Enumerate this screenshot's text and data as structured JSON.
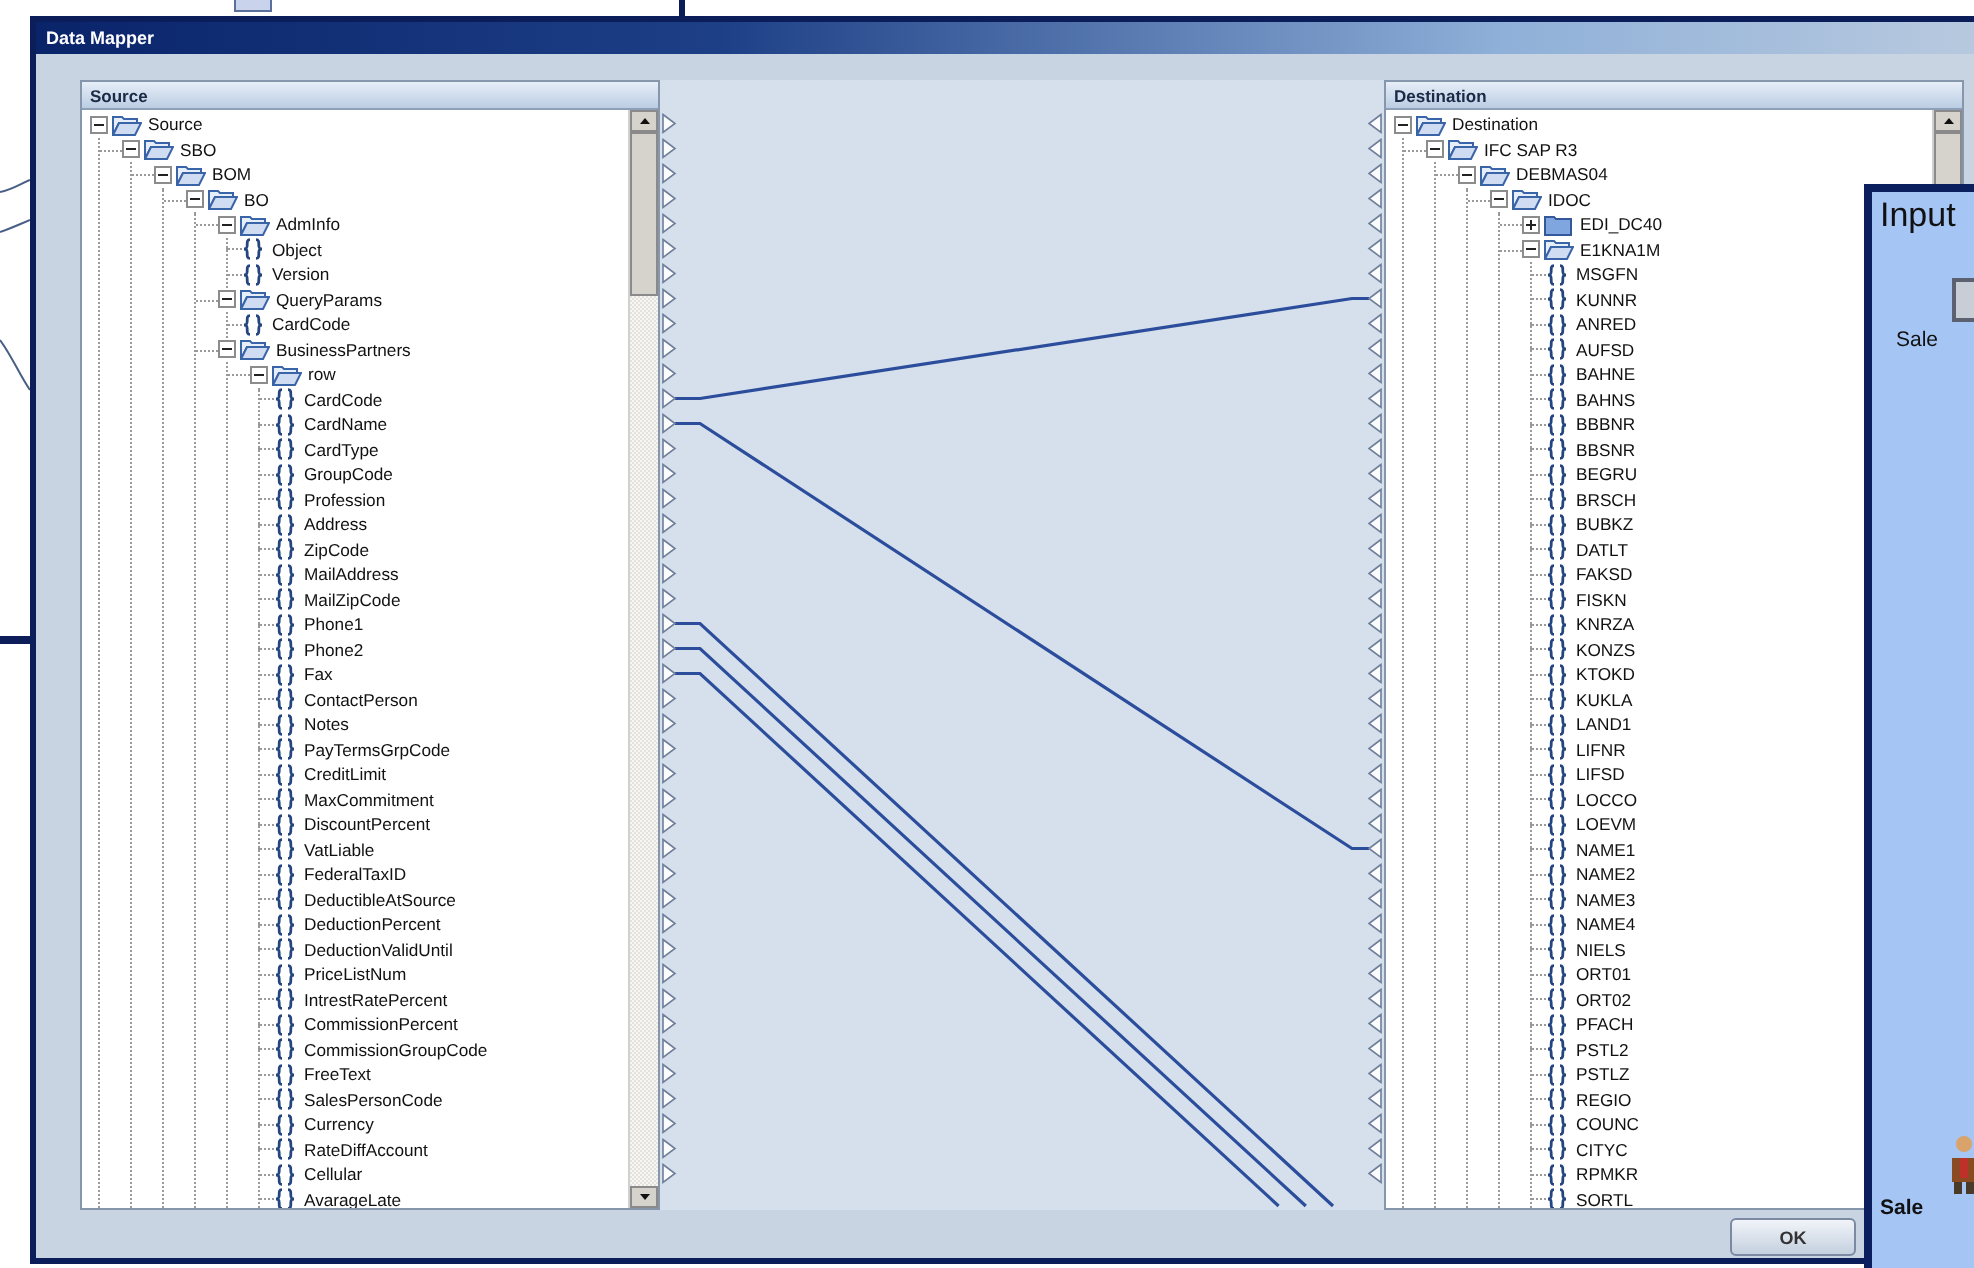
{
  "window": {
    "title": "Data Mapper"
  },
  "source": {
    "title": "Source",
    "tree": [
      {
        "label": "Source",
        "kind": "folder",
        "expanded": true,
        "children": [
          {
            "label": "SBO",
            "kind": "folder",
            "expanded": true,
            "children": [
              {
                "label": "BOM",
                "kind": "folder",
                "expanded": true,
                "children": [
                  {
                    "label": "BO",
                    "kind": "folder",
                    "expanded": true,
                    "children": [
                      {
                        "label": "AdmInfo",
                        "kind": "folder",
                        "expanded": true,
                        "children": [
                          {
                            "label": "Object",
                            "kind": "field",
                            "connected": false
                          },
                          {
                            "label": "Version",
                            "kind": "field",
                            "connected": false
                          }
                        ]
                      },
                      {
                        "label": "QueryParams",
                        "kind": "folder",
                        "expanded": true,
                        "children": [
                          {
                            "label": "CardCode",
                            "kind": "field",
                            "connected": false
                          }
                        ]
                      },
                      {
                        "label": "BusinessPartners",
                        "kind": "folder",
                        "expanded": true,
                        "children": [
                          {
                            "label": "row",
                            "kind": "folder",
                            "expanded": true,
                            "children": [
                              {
                                "label": "CardCode",
                                "kind": "field",
                                "connected": true
                              },
                              {
                                "label": "CardName",
                                "kind": "field",
                                "connected": true
                              },
                              {
                                "label": "CardType",
                                "kind": "field",
                                "connected": false
                              },
                              {
                                "label": "GroupCode",
                                "kind": "field",
                                "connected": false
                              },
                              {
                                "label": "Profession",
                                "kind": "field",
                                "connected": false
                              },
                              {
                                "label": "Address",
                                "kind": "field",
                                "connected": false
                              },
                              {
                                "label": "ZipCode",
                                "kind": "field",
                                "connected": false
                              },
                              {
                                "label": "MailAddress",
                                "kind": "field",
                                "connected": false
                              },
                              {
                                "label": "MailZipCode",
                                "kind": "field",
                                "connected": false
                              },
                              {
                                "label": "Phone1",
                                "kind": "field",
                                "connected": true
                              },
                              {
                                "label": "Phone2",
                                "kind": "field",
                                "connected": true
                              },
                              {
                                "label": "Fax",
                                "kind": "field",
                                "connected": true
                              },
                              {
                                "label": "ContactPerson",
                                "kind": "field",
                                "connected": false
                              },
                              {
                                "label": "Notes",
                                "kind": "field",
                                "connected": false
                              },
                              {
                                "label": "PayTermsGrpCode",
                                "kind": "field",
                                "connected": false
                              },
                              {
                                "label": "CreditLimit",
                                "kind": "field",
                                "connected": false
                              },
                              {
                                "label": "MaxCommitment",
                                "kind": "field",
                                "connected": false
                              },
                              {
                                "label": "DiscountPercent",
                                "kind": "field",
                                "connected": false
                              },
                              {
                                "label": "VatLiable",
                                "kind": "field",
                                "connected": false
                              },
                              {
                                "label": "FederalTaxID",
                                "kind": "field",
                                "connected": false
                              },
                              {
                                "label": "DeductibleAtSource",
                                "kind": "field",
                                "connected": false
                              },
                              {
                                "label": "DeductionPercent",
                                "kind": "field",
                                "connected": false
                              },
                              {
                                "label": "DeductionValidUntil",
                                "kind": "field",
                                "connected": false
                              },
                              {
                                "label": "PriceListNum",
                                "kind": "field",
                                "connected": false
                              },
                              {
                                "label": "IntrestRatePercent",
                                "kind": "field",
                                "connected": false
                              },
                              {
                                "label": "CommissionPercent",
                                "kind": "field",
                                "connected": false
                              },
                              {
                                "label": "CommissionGroupCode",
                                "kind": "field",
                                "connected": false
                              },
                              {
                                "label": "FreeText",
                                "kind": "field",
                                "connected": false
                              },
                              {
                                "label": "SalesPersonCode",
                                "kind": "field",
                                "connected": false
                              },
                              {
                                "label": "Currency",
                                "kind": "field",
                                "connected": false
                              },
                              {
                                "label": "RateDiffAccount",
                                "kind": "field",
                                "connected": false
                              },
                              {
                                "label": "Cellular",
                                "kind": "field",
                                "connected": false
                              },
                              {
                                "label": "AvarageLate",
                                "kind": "field",
                                "connected": false
                              }
                            ]
                          }
                        ]
                      }
                    ]
                  }
                ]
              }
            ]
          }
        ]
      }
    ]
  },
  "destination": {
    "title": "Destination",
    "tree": [
      {
        "label": "Destination",
        "kind": "folder",
        "expanded": true,
        "children": [
          {
            "label": "IFC SAP R3",
            "kind": "folder",
            "expanded": true,
            "children": [
              {
                "label": "DEBMAS04",
                "kind": "folder",
                "expanded": true,
                "children": [
                  {
                    "label": "IDOC",
                    "kind": "folder",
                    "expanded": true,
                    "children": [
                      {
                        "label": "EDI_DC40",
                        "kind": "folder",
                        "expanded": false
                      },
                      {
                        "label": "E1KNA1M",
                        "kind": "folder",
                        "expanded": true,
                        "children": [
                          {
                            "label": "MSGFN",
                            "kind": "field",
                            "connected": false
                          },
                          {
                            "label": "KUNNR",
                            "kind": "field",
                            "connected": true
                          },
                          {
                            "label": "ANRED",
                            "kind": "field",
                            "connected": false
                          },
                          {
                            "label": "AUFSD",
                            "kind": "field",
                            "connected": false
                          },
                          {
                            "label": "BAHNE",
                            "kind": "field",
                            "connected": false
                          },
                          {
                            "label": "BAHNS",
                            "kind": "field",
                            "connected": false
                          },
                          {
                            "label": "BBBNR",
                            "kind": "field",
                            "connected": false
                          },
                          {
                            "label": "BBSNR",
                            "kind": "field",
                            "connected": false
                          },
                          {
                            "label": "BEGRU",
                            "kind": "field",
                            "connected": false
                          },
                          {
                            "label": "BRSCH",
                            "kind": "field",
                            "connected": false
                          },
                          {
                            "label": "BUBKZ",
                            "kind": "field",
                            "connected": false
                          },
                          {
                            "label": "DATLT",
                            "kind": "field",
                            "connected": false
                          },
                          {
                            "label": "FAKSD",
                            "kind": "field",
                            "connected": false
                          },
                          {
                            "label": "FISKN",
                            "kind": "field",
                            "connected": false
                          },
                          {
                            "label": "KNRZA",
                            "kind": "field",
                            "connected": false
                          },
                          {
                            "label": "KONZS",
                            "kind": "field",
                            "connected": false
                          },
                          {
                            "label": "KTOKD",
                            "kind": "field",
                            "connected": false
                          },
                          {
                            "label": "KUKLA",
                            "kind": "field",
                            "connected": false
                          },
                          {
                            "label": "LAND1",
                            "kind": "field",
                            "connected": false
                          },
                          {
                            "label": "LIFNR",
                            "kind": "field",
                            "connected": false
                          },
                          {
                            "label": "LIFSD",
                            "kind": "field",
                            "connected": false
                          },
                          {
                            "label": "LOCCO",
                            "kind": "field",
                            "connected": false
                          },
                          {
                            "label": "LOEVM",
                            "kind": "field",
                            "connected": false
                          },
                          {
                            "label": "NAME1",
                            "kind": "field",
                            "connected": true
                          },
                          {
                            "label": "NAME2",
                            "kind": "field",
                            "connected": false
                          },
                          {
                            "label": "NAME3",
                            "kind": "field",
                            "connected": false
                          },
                          {
                            "label": "NAME4",
                            "kind": "field",
                            "connected": false
                          },
                          {
                            "label": "NIELS",
                            "kind": "field",
                            "connected": false
                          },
                          {
                            "label": "ORT01",
                            "kind": "field",
                            "connected": false
                          },
                          {
                            "label": "ORT02",
                            "kind": "field",
                            "connected": false
                          },
                          {
                            "label": "PFACH",
                            "kind": "field",
                            "connected": false
                          },
                          {
                            "label": "PSTL2",
                            "kind": "field",
                            "connected": false
                          },
                          {
                            "label": "PSTLZ",
                            "kind": "field",
                            "connected": false
                          },
                          {
                            "label": "REGIO",
                            "kind": "field",
                            "connected": false
                          },
                          {
                            "label": "COUNC",
                            "kind": "field",
                            "connected": false
                          },
                          {
                            "label": "CITYC",
                            "kind": "field",
                            "connected": false
                          },
                          {
                            "label": "RPMKR",
                            "kind": "field",
                            "connected": false
                          },
                          {
                            "label": "SORTL",
                            "kind": "field",
                            "connected": false
                          }
                        ]
                      }
                    ]
                  }
                ]
              }
            ]
          }
        ]
      }
    ]
  },
  "buttons": [
    "OK"
  ],
  "input_window": {
    "title": "Input",
    "labels": [
      "Sale",
      "Sale"
    ]
  }
}
